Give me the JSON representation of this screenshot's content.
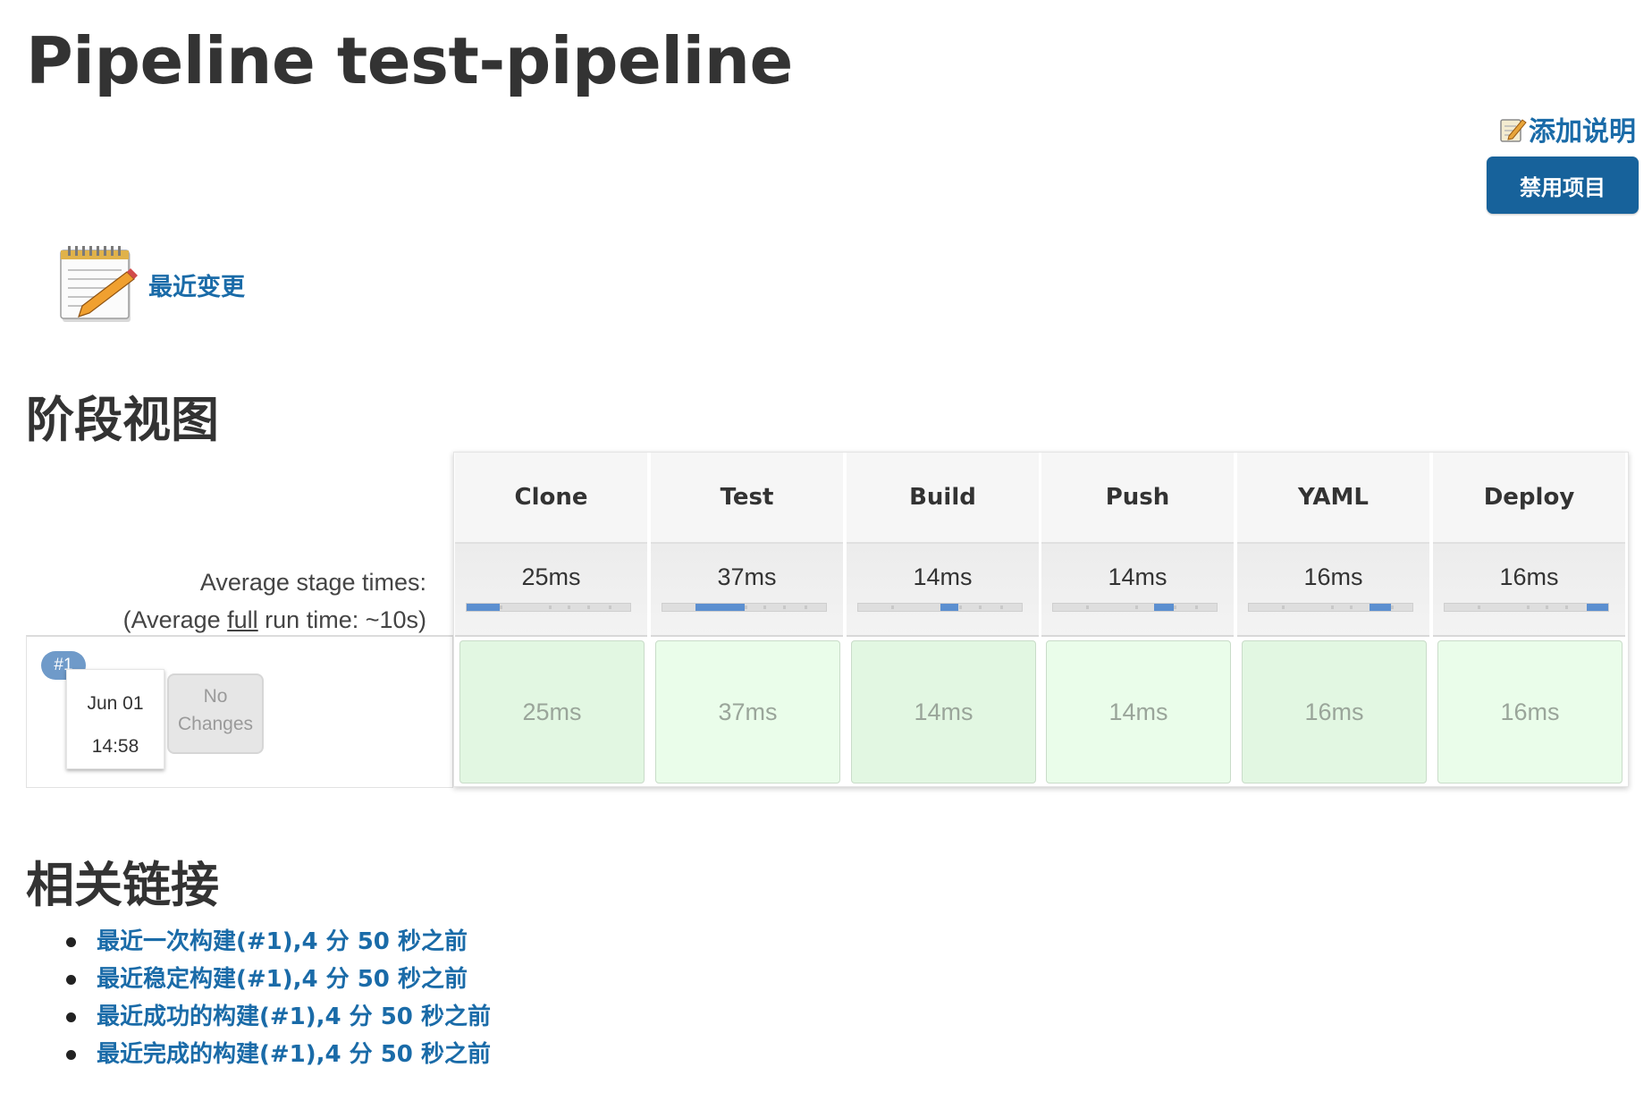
{
  "page": {
    "title": "Pipeline test-pipeline"
  },
  "actions": {
    "add_description": "添加说明",
    "disable_project": "禁用项目"
  },
  "recent_changes": {
    "label": "最近变更",
    "icon": "notepad-icon"
  },
  "stage_view": {
    "heading": "阶段视图",
    "average_label_line1": "Average stage times:",
    "average_label_prefix": "(Average ",
    "average_label_full": "full",
    "average_label_suffix": " run time: ~10s)",
    "stages": [
      {
        "name": "Clone",
        "avg": "25ms",
        "run": "25ms",
        "bar_start": 0.0,
        "bar_width": 0.2
      },
      {
        "name": "Test",
        "avg": "37ms",
        "run": "37ms",
        "bar_start": 0.2,
        "bar_width": 0.3
      },
      {
        "name": "Build",
        "avg": "14ms",
        "run": "14ms",
        "bar_start": 0.5,
        "bar_width": 0.11
      },
      {
        "name": "Push",
        "avg": "14ms",
        "run": "14ms",
        "bar_start": 0.62,
        "bar_width": 0.12
      },
      {
        "name": "YAML",
        "avg": "16ms",
        "run": "16ms",
        "bar_start": 0.74,
        "bar_width": 0.13
      },
      {
        "name": "Deploy",
        "avg": "16ms",
        "run": "16ms",
        "bar_start": 0.87,
        "bar_width": 0.13
      }
    ],
    "build": {
      "badge": "#1",
      "date": "Jun 01",
      "time": "14:58",
      "changes_line1": "No",
      "changes_line2": "Changes"
    }
  },
  "related": {
    "heading": "相关链接",
    "links": [
      "最近一次构建(#1),4 分 50 秒之前",
      "最近稳定构建(#1),4 分 50 秒之前",
      "最近成功的构建(#1),4 分 50 秒之前",
      "最近完成的构建(#1),4 分 50 秒之前"
    ]
  },
  "colors": {
    "link": "#1a6ba8",
    "button": "#17629b",
    "success_cell": "#e2f7e2",
    "progress": "#5b8fd0"
  }
}
